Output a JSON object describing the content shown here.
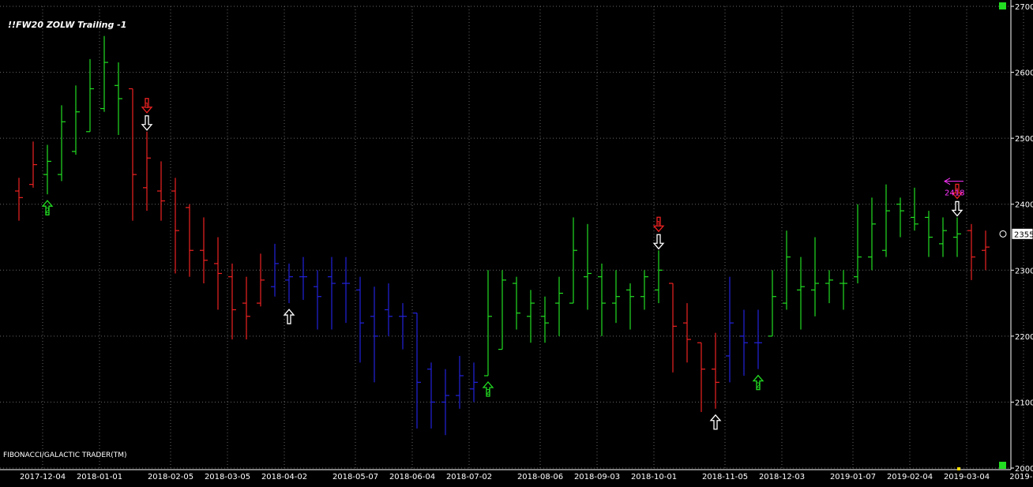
{
  "chart_data": {
    "type": "ohlc",
    "title": "!!FW20 ZOLW Trailing -1",
    "footer": "FIBONACCI/GALACTIC TRADER(TM)",
    "ylim": [
      2000,
      2700
    ],
    "yticks": [
      2000,
      2100,
      2200,
      2300,
      2400,
      2500,
      2600,
      2700
    ],
    "xticks": [
      {
        "i": 1,
        "label": "2017-12-04"
      },
      {
        "i": 5,
        "label": "2018-01-01"
      },
      {
        "i": 10,
        "label": "2018-02-05"
      },
      {
        "i": 14,
        "label": "2018-03-05"
      },
      {
        "i": 18,
        "label": "2018-04-02"
      },
      {
        "i": 23,
        "label": "2018-05-07"
      },
      {
        "i": 27,
        "label": "2018-06-04"
      },
      {
        "i": 31,
        "label": "2018-07-02"
      },
      {
        "i": 36,
        "label": "2018-08-06"
      },
      {
        "i": 40,
        "label": "2018-09-03"
      },
      {
        "i": 44,
        "label": "2018-10-01"
      },
      {
        "i": 49,
        "label": "2018-11-05"
      },
      {
        "i": 53,
        "label": "2018-12-03"
      },
      {
        "i": 58,
        "label": "2019-01-07"
      },
      {
        "i": 62,
        "label": "2019-02-04"
      },
      {
        "i": 66,
        "label": "2019-03-04"
      },
      {
        "i": 70,
        "label": "2019-0"
      }
    ],
    "grid": true,
    "colors": {
      "up": "#22dd22",
      "down": "#ee2222",
      "neutral": "#2222dd",
      "signal_red": "#ee2222",
      "signal_white": "#ffffff",
      "signal_green": "#22dd22",
      "target": "#ff33ff",
      "grid": "#666666",
      "axis": "#ffffff"
    },
    "bars": [
      {
        "o": 2420,
        "h": 2440,
        "l": 2375,
        "c": 2410,
        "color": "down"
      },
      {
        "o": 2430,
        "h": 2495,
        "l": 2425,
        "c": 2460,
        "color": "down"
      },
      {
        "o": 2445,
        "h": 2490,
        "l": 2415,
        "c": 2465,
        "color": "up"
      },
      {
        "o": 2445,
        "h": 2550,
        "l": 2435,
        "c": 2525,
        "color": "up"
      },
      {
        "o": 2480,
        "h": 2580,
        "l": 2475,
        "c": 2540,
        "color": "up"
      },
      {
        "o": 2510,
        "h": 2620,
        "l": 2510,
        "c": 2575,
        "color": "up"
      },
      {
        "o": 2545,
        "h": 2655,
        "l": 2540,
        "c": 2615,
        "color": "up"
      },
      {
        "o": 2580,
        "h": 2615,
        "l": 2505,
        "c": 2560,
        "color": "up"
      },
      {
        "o": 2575,
        "h": 2575,
        "l": 2375,
        "c": 2445,
        "color": "down"
      },
      {
        "o": 2425,
        "h": 2510,
        "l": 2390,
        "c": 2470,
        "color": "down"
      },
      {
        "o": 2420,
        "h": 2465,
        "l": 2375,
        "c": 2405,
        "color": "down"
      },
      {
        "o": 2420,
        "h": 2440,
        "l": 2295,
        "c": 2360,
        "color": "down"
      },
      {
        "o": 2395,
        "h": 2400,
        "l": 2290,
        "c": 2330,
        "color": "down"
      },
      {
        "o": 2330,
        "h": 2380,
        "l": 2280,
        "c": 2315,
        "color": "down"
      },
      {
        "o": 2310,
        "h": 2350,
        "l": 2240,
        "c": 2295,
        "color": "down"
      },
      {
        "o": 2290,
        "h": 2310,
        "l": 2195,
        "c": 2240,
        "color": "down"
      },
      {
        "o": 2250,
        "h": 2290,
        "l": 2195,
        "c": 2230,
        "color": "down"
      },
      {
        "o": 2250,
        "h": 2325,
        "l": 2245,
        "c": 2285,
        "color": "down"
      },
      {
        "o": 2275,
        "h": 2340,
        "l": 2260,
        "c": 2310,
        "color": "neutral"
      },
      {
        "o": 2285,
        "h": 2310,
        "l": 2250,
        "c": 2290,
        "color": "neutral"
      },
      {
        "o": 2290,
        "h": 2320,
        "l": 2255,
        "c": 2290,
        "color": "neutral"
      },
      {
        "o": 2275,
        "h": 2300,
        "l": 2210,
        "c": 2260,
        "color": "neutral"
      },
      {
        "o": 2290,
        "h": 2320,
        "l": 2210,
        "c": 2280,
        "color": "neutral"
      },
      {
        "o": 2280,
        "h": 2320,
        "l": 2220,
        "c": 2280,
        "color": "neutral"
      },
      {
        "o": 2270,
        "h": 2290,
        "l": 2160,
        "c": 2220,
        "color": "neutral"
      },
      {
        "o": 2230,
        "h": 2275,
        "l": 2130,
        "c": 2200,
        "color": "neutral"
      },
      {
        "o": 2240,
        "h": 2280,
        "l": 2200,
        "c": 2230,
        "color": "neutral"
      },
      {
        "o": 2230,
        "h": 2250,
        "l": 2180,
        "c": 2230,
        "color": "neutral"
      },
      {
        "o": 2235,
        "h": 2235,
        "l": 2060,
        "c": 2130,
        "color": "neutral"
      },
      {
        "o": 2150,
        "h": 2160,
        "l": 2060,
        "c": 2100,
        "color": "neutral"
      },
      {
        "o": 2100,
        "h": 2150,
        "l": 2050,
        "c": 2110,
        "color": "neutral"
      },
      {
        "o": 2110,
        "h": 2170,
        "l": 2090,
        "c": 2140,
        "color": "neutral"
      },
      {
        "o": 2120,
        "h": 2160,
        "l": 2100,
        "c": 2130,
        "color": "neutral"
      },
      {
        "o": 2140,
        "h": 2300,
        "l": 2140,
        "c": 2230,
        "color": "up"
      },
      {
        "o": 2180,
        "h": 2300,
        "l": 2180,
        "c": 2285,
        "color": "up"
      },
      {
        "o": 2280,
        "h": 2290,
        "l": 2210,
        "c": 2235,
        "color": "up"
      },
      {
        "o": 2230,
        "h": 2270,
        "l": 2190,
        "c": 2250,
        "color": "up"
      },
      {
        "o": 2230,
        "h": 2260,
        "l": 2190,
        "c": 2220,
        "color": "up"
      },
      {
        "o": 2250,
        "h": 2290,
        "l": 2200,
        "c": 2265,
        "color": "up"
      },
      {
        "o": 2250,
        "h": 2380,
        "l": 2250,
        "c": 2330,
        "color": "up"
      },
      {
        "o": 2290,
        "h": 2370,
        "l": 2240,
        "c": 2295,
        "color": "up"
      },
      {
        "o": 2290,
        "h": 2310,
        "l": 2200,
        "c": 2250,
        "color": "up"
      },
      {
        "o": 2250,
        "h": 2300,
        "l": 2220,
        "c": 2260,
        "color": "up"
      },
      {
        "o": 2270,
        "h": 2280,
        "l": 2210,
        "c": 2260,
        "color": "up"
      },
      {
        "o": 2260,
        "h": 2300,
        "l": 2240,
        "c": 2290,
        "color": "up"
      },
      {
        "o": 2270,
        "h": 2330,
        "l": 2250,
        "c": 2300,
        "color": "up"
      },
      {
        "o": 2280,
        "h": 2280,
        "l": 2145,
        "c": 2215,
        "color": "down"
      },
      {
        "o": 2220,
        "h": 2250,
        "l": 2160,
        "c": 2195,
        "color": "down"
      },
      {
        "o": 2190,
        "h": 2190,
        "l": 2085,
        "c": 2150,
        "color": "down"
      },
      {
        "o": 2150,
        "h": 2205,
        "l": 2090,
        "c": 2130,
        "color": "down"
      },
      {
        "o": 2170,
        "h": 2290,
        "l": 2130,
        "c": 2220,
        "color": "neutral"
      },
      {
        "o": 2200,
        "h": 2240,
        "l": 2140,
        "c": 2190,
        "color": "neutral"
      },
      {
        "o": 2190,
        "h": 2240,
        "l": 2150,
        "c": 2190,
        "color": "neutral"
      },
      {
        "o": 2200,
        "h": 2300,
        "l": 2200,
        "c": 2260,
        "color": "up"
      },
      {
        "o": 2250,
        "h": 2360,
        "l": 2240,
        "c": 2320,
        "color": "up"
      },
      {
        "o": 2270,
        "h": 2320,
        "l": 2210,
        "c": 2275,
        "color": "up"
      },
      {
        "o": 2270,
        "h": 2350,
        "l": 2230,
        "c": 2280,
        "color": "up"
      },
      {
        "o": 2280,
        "h": 2300,
        "l": 2250,
        "c": 2285,
        "color": "up"
      },
      {
        "o": 2280,
        "h": 2300,
        "l": 2240,
        "c": 2280,
        "color": "up"
      },
      {
        "o": 2290,
        "h": 2400,
        "l": 2280,
        "c": 2320,
        "color": "up"
      },
      {
        "o": 2320,
        "h": 2410,
        "l": 2300,
        "c": 2370,
        "color": "up"
      },
      {
        "o": 2330,
        "h": 2430,
        "l": 2320,
        "c": 2390,
        "color": "up"
      },
      {
        "o": 2400,
        "h": 2410,
        "l": 2350,
        "c": 2390,
        "color": "up"
      },
      {
        "o": 2380,
        "h": 2425,
        "l": 2360,
        "c": 2370,
        "color": "up"
      },
      {
        "o": 2380,
        "h": 2390,
        "l": 2320,
        "c": 2350,
        "color": "up"
      },
      {
        "o": 2340,
        "h": 2380,
        "l": 2320,
        "c": 2360,
        "color": "up"
      },
      {
        "o": 2350,
        "h": 2380,
        "l": 2320,
        "c": 2355,
        "color": "up"
      },
      {
        "o": 2360,
        "h": 2370,
        "l": 2285,
        "c": 2320,
        "color": "down"
      },
      {
        "o": 2330,
        "h": 2360,
        "l": 2300,
        "c": 2335,
        "color": "down"
      }
    ],
    "signals": [
      {
        "i": 2,
        "type": "arrow-up",
        "color": "signal_green",
        "label": "2",
        "anchor": "below"
      },
      {
        "i": 9,
        "type": "arrow-down",
        "color": "signal_red",
        "label": "1",
        "anchor": "above2"
      },
      {
        "i": 9,
        "type": "arrow-down",
        "color": "signal_white",
        "label": "",
        "anchor": "above"
      },
      {
        "i": 19,
        "type": "arrow-up",
        "color": "signal_white",
        "label": "",
        "anchor": "below"
      },
      {
        "i": 33,
        "type": "arrow-up",
        "color": "signal_green",
        "label": "2",
        "anchor": "below"
      },
      {
        "i": 45,
        "type": "arrow-down",
        "color": "signal_red",
        "label": "1",
        "anchor": "above2"
      },
      {
        "i": 45,
        "type": "arrow-down",
        "color": "signal_white",
        "label": "",
        "anchor": "above"
      },
      {
        "i": 49,
        "type": "arrow-up",
        "color": "signal_white",
        "label": "",
        "anchor": "below"
      },
      {
        "i": 52,
        "type": "arrow-up",
        "color": "signal_green",
        "label": "2",
        "anchor": "below"
      },
      {
        "i": 66,
        "type": "arrow-down",
        "color": "signal_red",
        "label": "1",
        "anchor": "above2"
      },
      {
        "i": 66,
        "type": "arrow-down",
        "color": "signal_white",
        "label": "",
        "anchor": "above"
      }
    ],
    "target": {
      "value": 2418,
      "label": "2418"
    },
    "last_price": {
      "value": 2355,
      "label": "2355"
    }
  }
}
